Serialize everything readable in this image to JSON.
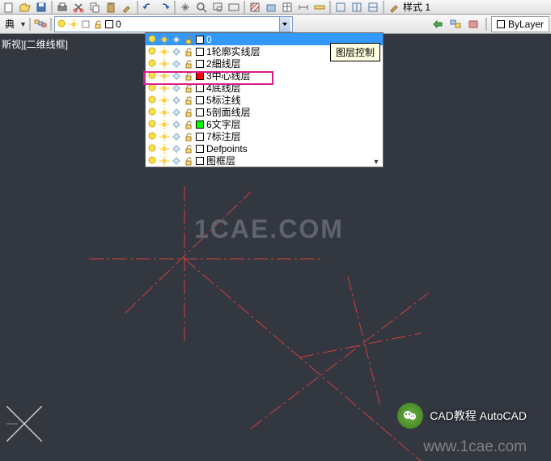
{
  "toolbar_icons": [
    "file",
    "open",
    "save",
    "print",
    "cut",
    "copy",
    "paste",
    "match",
    "undo",
    "redo",
    "pan",
    "zoom",
    "zoom-window",
    "zoom-ext",
    "layer-prev",
    "layer-iso",
    "hatch",
    "block",
    "table",
    "dim",
    "measure",
    "sep",
    "view1",
    "view2",
    "view3",
    "properties"
  ],
  "second_bar": {
    "left_label": "典",
    "style_label": "样式 1",
    "bylayer": "ByLayer",
    "combo_selected": "0"
  },
  "layers": [
    {
      "name": "0",
      "color": "#ffffff",
      "selected": true
    },
    {
      "name": "1轮廓实线层",
      "color": "#ffffff"
    },
    {
      "name": "2细线层",
      "color": "#ffffff"
    },
    {
      "name": "3中心线层",
      "color": "#ff0000",
      "highlight": true
    },
    {
      "name": "4底线层",
      "color": "#ffffff"
    },
    {
      "name": "5标注线",
      "color": "#ffffff"
    },
    {
      "name": "5剖面线层",
      "color": "#ffffff"
    },
    {
      "name": "6文字层",
      "color": "#00ff00"
    },
    {
      "name": "7标注层",
      "color": "#ffffff"
    },
    {
      "name": "Defpoints",
      "color": "#ffffff"
    },
    {
      "name": "图框层",
      "color": "#ffffff"
    }
  ],
  "tooltip": "图层控制",
  "view_label": "斯视][二维线框]",
  "watermark1": "1CAE.COM",
  "watermark2": "www.1cae.com",
  "chat_label": "CAD教程 AutoCAD"
}
